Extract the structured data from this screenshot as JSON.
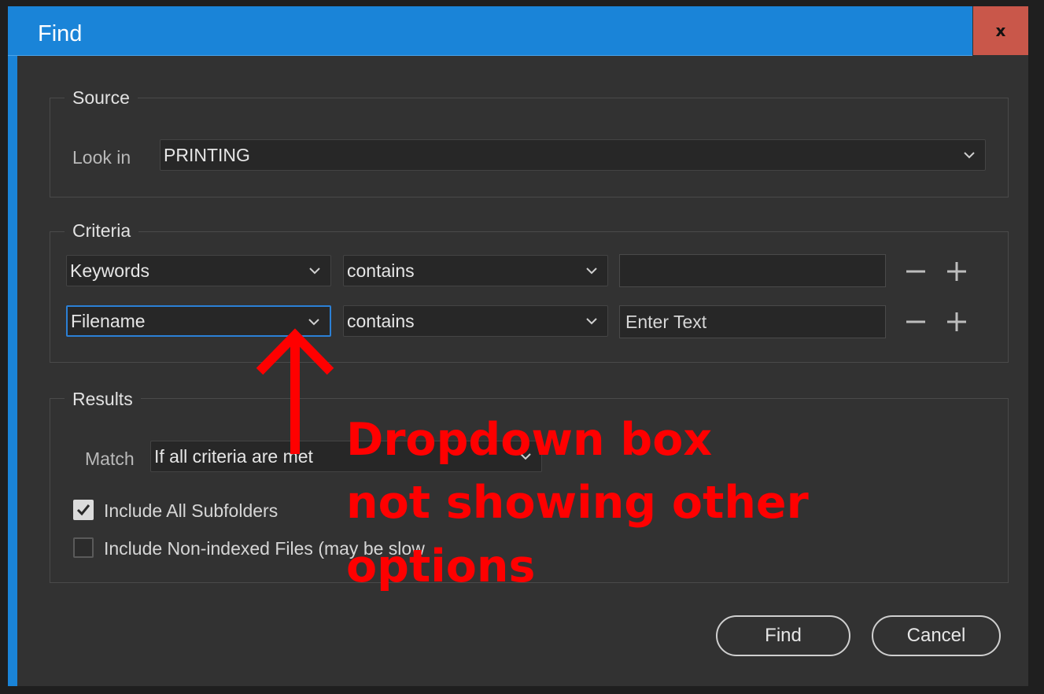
{
  "window": {
    "title": "Find",
    "close_label": "x"
  },
  "source": {
    "group_label": "Source",
    "look_in_label": "Look in",
    "look_in_value": "PRINTING"
  },
  "criteria": {
    "group_label": "Criteria",
    "rows": [
      {
        "field": "Keywords",
        "operator": "contains",
        "value": "",
        "placeholder": ""
      },
      {
        "field": "Filename",
        "operator": "contains",
        "value": "",
        "placeholder": "Enter Text"
      }
    ]
  },
  "results": {
    "group_label": "Results",
    "match_label": "Match",
    "match_value": "If all criteria are met",
    "include_subfolders": {
      "label": "Include All Subfolders",
      "checked": true
    },
    "include_nonindexed": {
      "label": "Include Non-indexed Files (may be slow",
      "checked": false
    }
  },
  "buttons": {
    "find": "Find",
    "cancel": "Cancel"
  },
  "annotation": {
    "lines": [
      "Dropdown box",
      "not showing other",
      "options"
    ],
    "color": "#ff0000"
  },
  "colors": {
    "accent": "#1a84d8",
    "close": "#c9574a",
    "background": "#323232"
  },
  "icons": [
    "close-icon",
    "chevron-down-icon",
    "minus-icon",
    "plus-icon",
    "checkmark-icon",
    "arrow-up-icon"
  ]
}
